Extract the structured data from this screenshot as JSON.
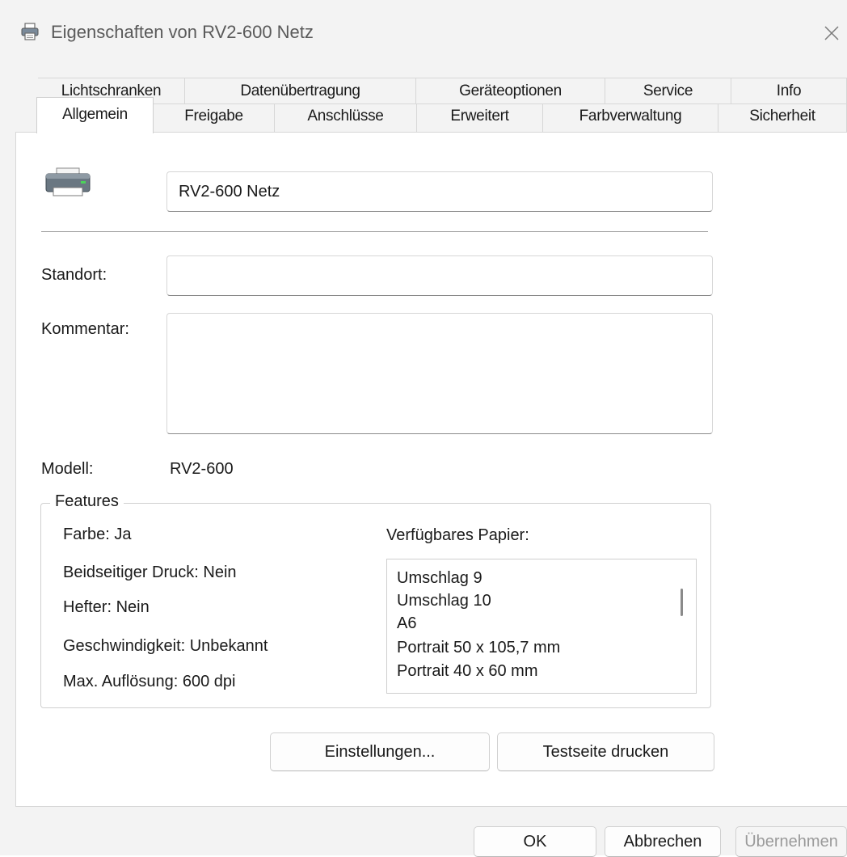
{
  "window": {
    "title": "Eigenschaften von RV2-600 Netz",
    "icon": "printer-icon",
    "close_icon": "close-icon"
  },
  "tabs": {
    "row1": [
      "Lichtschranken",
      "Datenübertragung",
      "Geräteoptionen",
      "Service",
      "Info"
    ],
    "row2": [
      "Allgemein",
      "Freigabe",
      "Anschlüsse",
      "Erweitert",
      "Farbverwaltung",
      "Sicherheit"
    ],
    "active": "Allgemein"
  },
  "general": {
    "printer_name": "RV2-600 Netz",
    "location_label": "Standort:",
    "location_value": "",
    "comment_label": "Kommentar:",
    "comment_value": "",
    "model_label": "Modell:",
    "model_value": "RV2-600"
  },
  "features": {
    "title": "Features",
    "color": "Farbe: Ja",
    "duplex": "Beidseitiger Druck: Nein",
    "stapler": "Hefter: Nein",
    "speed": "Geschwindigkeit: Unbekannt",
    "resolution": "Max. Auflösung: 600 dpi",
    "paper_label": "Verfügbares Papier:",
    "paper_list": [
      "Umschlag 9",
      "Umschlag 10",
      "A6",
      "Portrait 50 x 105,7 mm",
      "Portrait 40 x 60 mm"
    ]
  },
  "buttons": {
    "settings": "Einstellungen...",
    "test_page": "Testseite drucken",
    "ok": "OK",
    "cancel": "Abbrechen",
    "apply": "Übernehmen"
  }
}
